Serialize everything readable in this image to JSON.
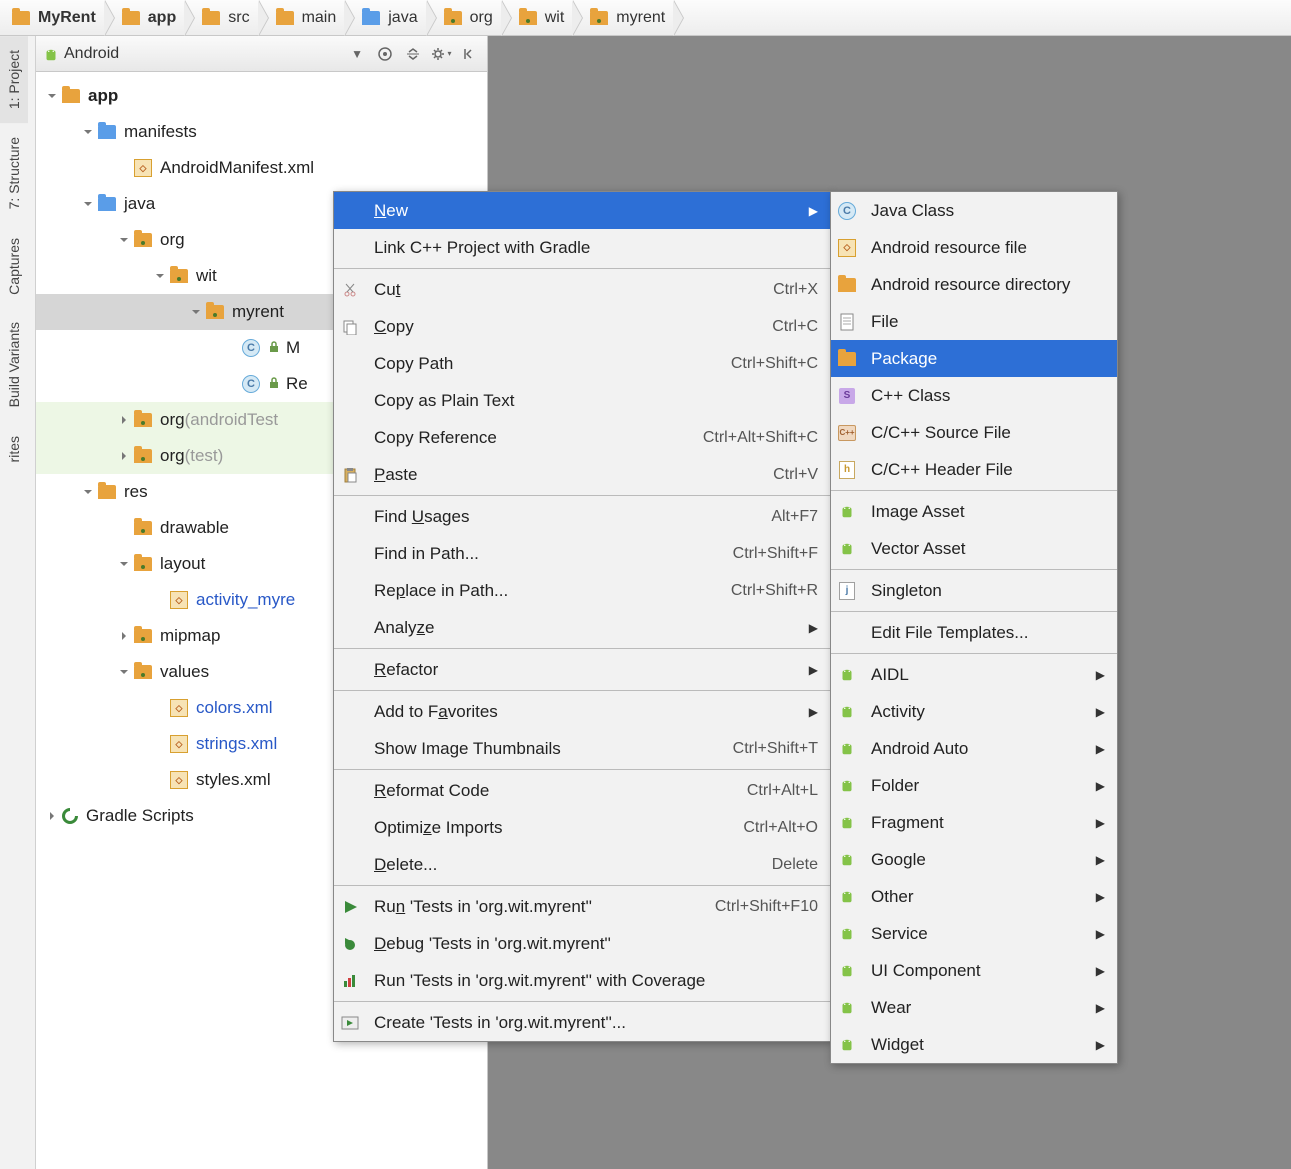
{
  "breadcrumb": [
    {
      "label": "MyRent",
      "bold": true,
      "icon": "folder"
    },
    {
      "label": "app",
      "bold": true,
      "icon": "folder"
    },
    {
      "label": "src",
      "bold": false,
      "icon": "folder"
    },
    {
      "label": "main",
      "bold": false,
      "icon": "folder"
    },
    {
      "label": "java",
      "bold": false,
      "icon": "folder-blue"
    },
    {
      "label": "org",
      "bold": false,
      "icon": "folder-dot"
    },
    {
      "label": "wit",
      "bold": false,
      "icon": "folder-dot"
    },
    {
      "label": "myrent",
      "bold": false,
      "icon": "folder-dot"
    }
  ],
  "left_tabs": [
    {
      "label": "1: Project",
      "icon": "project"
    },
    {
      "label": "7: Structure",
      "icon": "structure"
    },
    {
      "label": "Captures",
      "icon": "captures"
    },
    {
      "label": "Build Variants",
      "icon": "android"
    },
    {
      "label": "rites",
      "icon": ""
    }
  ],
  "panel": {
    "view_label": "Android"
  },
  "tree": [
    {
      "indent": 0,
      "arrow": "down",
      "icon": "folder",
      "label": "app",
      "bold": true
    },
    {
      "indent": 1,
      "arrow": "down",
      "icon": "folder-blue-plain",
      "label": "manifests"
    },
    {
      "indent": 2,
      "arrow": "",
      "icon": "manifest",
      "label": "AndroidManifest.xml"
    },
    {
      "indent": 1,
      "arrow": "down",
      "icon": "folder-blue-plain",
      "label": "java"
    },
    {
      "indent": 2,
      "arrow": "down",
      "icon": "folder-dot",
      "label": "org"
    },
    {
      "indent": 3,
      "arrow": "down",
      "icon": "folder-dot",
      "label": "wit"
    },
    {
      "indent": 4,
      "arrow": "down",
      "icon": "folder-dot",
      "label": "myrent",
      "selected": true
    },
    {
      "indent": 5,
      "arrow": "",
      "icon": "class",
      "label": "M",
      "lock": true
    },
    {
      "indent": 5,
      "arrow": "",
      "icon": "class",
      "label": "Re",
      "lock": true
    },
    {
      "indent": 2,
      "arrow": "right",
      "icon": "folder-dot",
      "label": "org",
      "suffix": "(androidTest",
      "highlight": true
    },
    {
      "indent": 2,
      "arrow": "right",
      "icon": "folder-dot",
      "label": "org",
      "suffix": "(test)",
      "highlight": true
    },
    {
      "indent": 1,
      "arrow": "down",
      "icon": "folder-res",
      "label": "res"
    },
    {
      "indent": 2,
      "arrow": "",
      "icon": "folder-dot",
      "label": "drawable"
    },
    {
      "indent": 2,
      "arrow": "down",
      "icon": "folder-dot",
      "label": "layout"
    },
    {
      "indent": 3,
      "arrow": "",
      "icon": "xml",
      "label": "activity_myre",
      "link": true
    },
    {
      "indent": 2,
      "arrow": "right",
      "icon": "folder-dot",
      "label": "mipmap"
    },
    {
      "indent": 2,
      "arrow": "down",
      "icon": "folder-dot",
      "label": "values"
    },
    {
      "indent": 3,
      "arrow": "",
      "icon": "xml",
      "label": "colors.xml",
      "link": true
    },
    {
      "indent": 3,
      "arrow": "",
      "icon": "xml",
      "label": "strings.xml",
      "link": true
    },
    {
      "indent": 3,
      "arrow": "",
      "icon": "xml",
      "label": "styles.xml"
    },
    {
      "indent": 0,
      "arrow": "right",
      "icon": "gradle",
      "label": "Gradle Scripts"
    }
  ],
  "context_menu": [
    {
      "label": "New",
      "u": "N",
      "highlighted": true,
      "arrow": true
    },
    {
      "label": "Link C++ Project with Gradle"
    },
    {
      "sep": true
    },
    {
      "label": "Cut",
      "u": "t",
      "icon": "cut",
      "shortcut": "Ctrl+X"
    },
    {
      "label": "Copy",
      "u": "C",
      "icon": "copy",
      "shortcut": "Ctrl+C"
    },
    {
      "label": "Copy Path",
      "shortcut": "Ctrl+Shift+C"
    },
    {
      "label": "Copy as Plain Text"
    },
    {
      "label": "Copy Reference",
      "shortcut": "Ctrl+Alt+Shift+C"
    },
    {
      "label": "Paste",
      "u": "P",
      "icon": "paste",
      "shortcut": "Ctrl+V"
    },
    {
      "sep": true
    },
    {
      "label": "Find Usages",
      "u": "U",
      "shortcut": "Alt+F7"
    },
    {
      "label": "Find in Path...",
      "shortcut": "Ctrl+Shift+F"
    },
    {
      "label": "Replace in Path...",
      "u": "p",
      "shortcut": "Ctrl+Shift+R"
    },
    {
      "label": "Analyze",
      "u": "z",
      "arrow": true
    },
    {
      "sep": true
    },
    {
      "label": "Refactor",
      "u": "R",
      "arrow": true
    },
    {
      "sep": true
    },
    {
      "label": "Add to Favorites",
      "u": "a",
      "arrow": true
    },
    {
      "label": "Show Image Thumbnails",
      "shortcut": "Ctrl+Shift+T"
    },
    {
      "sep": true
    },
    {
      "label": "Reformat Code",
      "u": "R",
      "shortcut": "Ctrl+Alt+L"
    },
    {
      "label": "Optimize Imports",
      "u": "z",
      "shortcut": "Ctrl+Alt+O"
    },
    {
      "label": "Delete...",
      "u": "D",
      "shortcut": "Delete"
    },
    {
      "sep": true
    },
    {
      "label": "Run 'Tests in 'org.wit.myrent''",
      "u": "n",
      "icon": "run",
      "shortcut": "Ctrl+Shift+F10"
    },
    {
      "label": "Debug 'Tests in 'org.wit.myrent''",
      "u": "D",
      "icon": "debug"
    },
    {
      "label": "Run 'Tests in 'org.wit.myrent'' with Coverage",
      "icon": "coverage"
    },
    {
      "sep": true
    },
    {
      "label": "Create 'Tests in 'org.wit.myrent''...",
      "icon": "create"
    }
  ],
  "submenu": [
    {
      "label": "Java Class",
      "icon": "class"
    },
    {
      "label": "Android resource file",
      "icon": "xml"
    },
    {
      "label": "Android resource directory",
      "icon": "folder"
    },
    {
      "label": "File",
      "icon": "file"
    },
    {
      "label": "Package",
      "icon": "folder",
      "highlighted": true
    },
    {
      "label": "C++ Class",
      "icon": "s-purple"
    },
    {
      "label": "C/C++ Source File",
      "icon": "cpp"
    },
    {
      "label": "C/C++ Header File",
      "icon": "h"
    },
    {
      "sep": true
    },
    {
      "label": "Image Asset",
      "icon": "android"
    },
    {
      "label": "Vector Asset",
      "icon": "android"
    },
    {
      "sep": true
    },
    {
      "label": "Singleton",
      "icon": "j"
    },
    {
      "sep": true
    },
    {
      "label": "Edit File Templates..."
    },
    {
      "sep": true
    },
    {
      "label": "AIDL",
      "icon": "android",
      "arrow": true
    },
    {
      "label": "Activity",
      "icon": "android",
      "arrow": true
    },
    {
      "label": "Android Auto",
      "icon": "android",
      "arrow": true
    },
    {
      "label": "Folder",
      "icon": "android",
      "arrow": true
    },
    {
      "label": "Fragment",
      "icon": "android",
      "arrow": true
    },
    {
      "label": "Google",
      "icon": "android",
      "arrow": true
    },
    {
      "label": "Other",
      "icon": "android",
      "arrow": true
    },
    {
      "label": "Service",
      "icon": "android",
      "arrow": true
    },
    {
      "label": "UI Component",
      "icon": "android",
      "arrow": true
    },
    {
      "label": "Wear",
      "icon": "android",
      "arrow": true
    },
    {
      "label": "Widget",
      "icon": "android",
      "arrow": true
    }
  ]
}
